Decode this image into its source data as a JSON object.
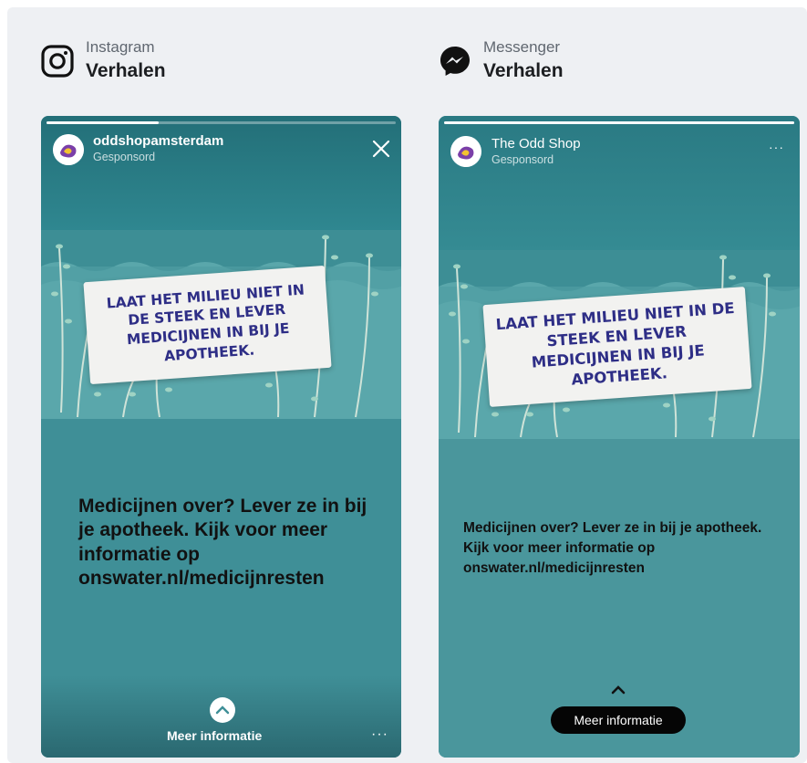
{
  "instagram": {
    "platform_name": "Instagram",
    "placement": "Verhalen",
    "icon": "instagram-icon",
    "account": "oddshopamsterdam",
    "sponsored": "Gesponsord",
    "artwork_text": "LAAT HET MILIEU NIET IN DE STEEK EN LEVER MEDICIJNEN IN BIJ JE APOTHEEK.",
    "caption": "Medicijnen over? Lever ze in bij je apotheek. Kijk voor meer informatie op onswater.nl/medicijnresten",
    "cta": "Meer informatie",
    "more": "···",
    "progress": 0.32
  },
  "messenger": {
    "platform_name": "Messenger",
    "placement": "Verhalen",
    "icon": "messenger-icon",
    "account": "The Odd Shop",
    "sponsored": "Gesponsord",
    "artwork_text": "LAAT HET MILIEU NIET IN DE STEEK EN LEVER MEDICIJNEN IN BIJ JE APOTHEEK.",
    "caption": "Medicijnen over? Lever ze in bij je apotheek. Kijk voor meer informatie op onswater.nl/medicijnresten",
    "cta": "Meer informatie",
    "more": "···",
    "progress": 1.0
  },
  "colors": {
    "story_bg": "#3f8f97",
    "artwork_card_text": "#2e2e86",
    "panel_bg": "#eef0f3"
  }
}
